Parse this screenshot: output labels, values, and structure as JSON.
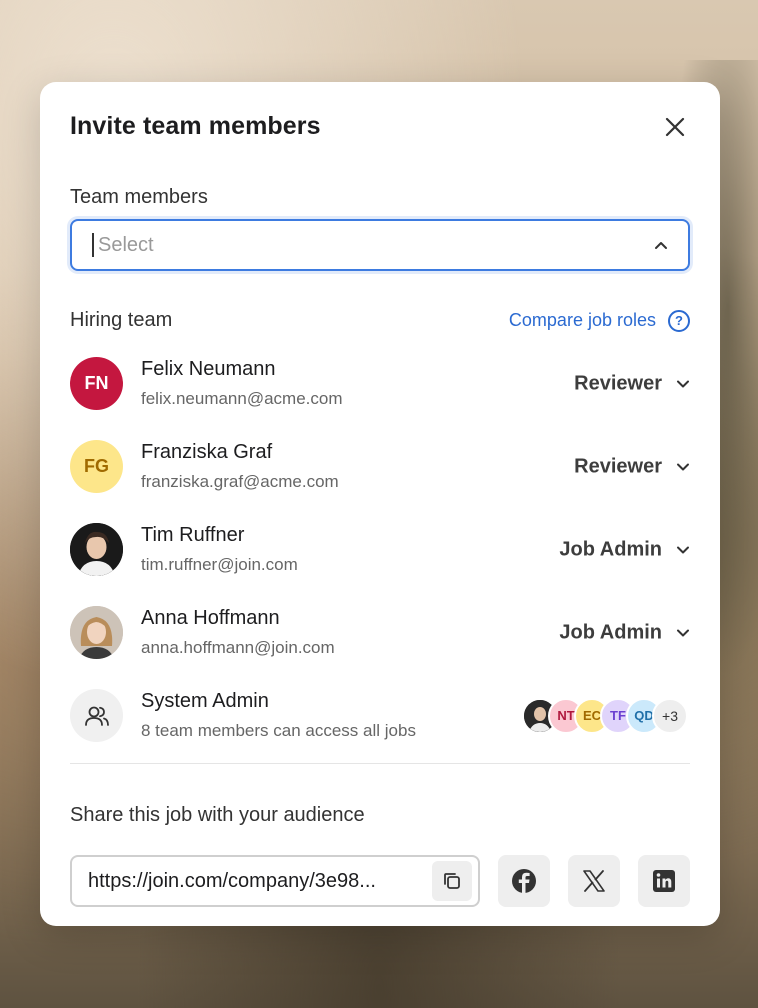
{
  "modal": {
    "title": "Invite team members"
  },
  "team_members": {
    "label": "Team members",
    "placeholder": "Select"
  },
  "hiring_team": {
    "title": "Hiring team",
    "compare_link": "Compare job roles",
    "help_icon": "?",
    "members": [
      {
        "initials": "FN",
        "name": "Felix Neumann",
        "email": "felix.neumann@acme.com",
        "role": "Reviewer",
        "avatar_bg": "#c4173f",
        "avatar_fg": "#ffffff"
      },
      {
        "initials": "FG",
        "name": "Franziska Graf",
        "email": "franziska.graf@acme.com",
        "role": "Reviewer",
        "avatar_bg": "#fde68a",
        "avatar_fg": "#a06a00"
      },
      {
        "initials": "",
        "name": "Tim Ruffner",
        "email": "tim.ruffner@join.com",
        "role": "Job Admin",
        "avatar": "photo"
      },
      {
        "initials": "",
        "name": "Anna Hoffmann",
        "email": "anna.hoffmann@join.com",
        "role": "Job Admin",
        "avatar": "photo"
      }
    ],
    "system_admin": {
      "name": "System Admin",
      "description": "8 team members can access all jobs",
      "avatars": [
        {
          "initials": "",
          "bg": "#2a2a2a",
          "fg": "#ffffff"
        },
        {
          "initials": "NT",
          "bg": "#fbc8d2",
          "fg": "#b0183e"
        },
        {
          "initials": "EC",
          "bg": "#fde68a",
          "fg": "#a06a00"
        },
        {
          "initials": "TF",
          "bg": "#e0d4fb",
          "fg": "#6b3fd1"
        },
        {
          "initials": "QD",
          "bg": "#cbe9fb",
          "fg": "#1f6fa8"
        }
      ],
      "more": "+3"
    }
  },
  "share": {
    "label": "Share this job with your audience",
    "url": "https://join.com/company/3e98..."
  },
  "icons": {
    "close": "close-icon",
    "chevron": "chevron-down-icon",
    "copy": "copy-icon",
    "facebook": "facebook-icon",
    "x": "x-icon",
    "linkedin": "linkedin-icon",
    "users": "users-icon"
  },
  "colors": {
    "accent": "#2b6ad1",
    "focus_border": "#3d7be0"
  }
}
